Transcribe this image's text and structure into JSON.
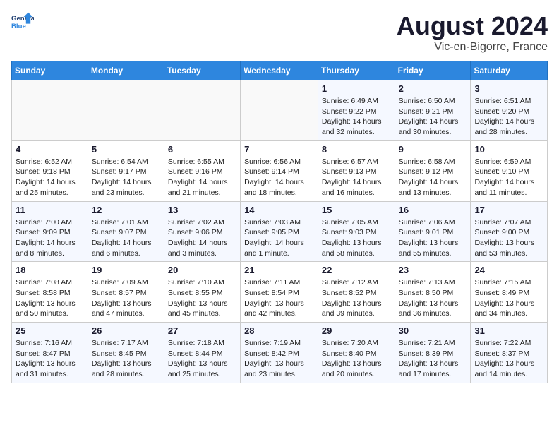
{
  "header": {
    "logo_line1": "General",
    "logo_line2": "Blue",
    "month_year": "August 2024",
    "location": "Vic-en-Bigorre, France"
  },
  "weekdays": [
    "Sunday",
    "Monday",
    "Tuesday",
    "Wednesday",
    "Thursday",
    "Friday",
    "Saturday"
  ],
  "weeks": [
    [
      {
        "day": "",
        "info": ""
      },
      {
        "day": "",
        "info": ""
      },
      {
        "day": "",
        "info": ""
      },
      {
        "day": "",
        "info": ""
      },
      {
        "day": "1",
        "info": "Sunrise: 6:49 AM\nSunset: 9:22 PM\nDaylight: 14 hours\nand 32 minutes."
      },
      {
        "day": "2",
        "info": "Sunrise: 6:50 AM\nSunset: 9:21 PM\nDaylight: 14 hours\nand 30 minutes."
      },
      {
        "day": "3",
        "info": "Sunrise: 6:51 AM\nSunset: 9:20 PM\nDaylight: 14 hours\nand 28 minutes."
      }
    ],
    [
      {
        "day": "4",
        "info": "Sunrise: 6:52 AM\nSunset: 9:18 PM\nDaylight: 14 hours\nand 25 minutes."
      },
      {
        "day": "5",
        "info": "Sunrise: 6:54 AM\nSunset: 9:17 PM\nDaylight: 14 hours\nand 23 minutes."
      },
      {
        "day": "6",
        "info": "Sunrise: 6:55 AM\nSunset: 9:16 PM\nDaylight: 14 hours\nand 21 minutes."
      },
      {
        "day": "7",
        "info": "Sunrise: 6:56 AM\nSunset: 9:14 PM\nDaylight: 14 hours\nand 18 minutes."
      },
      {
        "day": "8",
        "info": "Sunrise: 6:57 AM\nSunset: 9:13 PM\nDaylight: 14 hours\nand 16 minutes."
      },
      {
        "day": "9",
        "info": "Sunrise: 6:58 AM\nSunset: 9:12 PM\nDaylight: 14 hours\nand 13 minutes."
      },
      {
        "day": "10",
        "info": "Sunrise: 6:59 AM\nSunset: 9:10 PM\nDaylight: 14 hours\nand 11 minutes."
      }
    ],
    [
      {
        "day": "11",
        "info": "Sunrise: 7:00 AM\nSunset: 9:09 PM\nDaylight: 14 hours\nand 8 minutes."
      },
      {
        "day": "12",
        "info": "Sunrise: 7:01 AM\nSunset: 9:07 PM\nDaylight: 14 hours\nand 6 minutes."
      },
      {
        "day": "13",
        "info": "Sunrise: 7:02 AM\nSunset: 9:06 PM\nDaylight: 14 hours\nand 3 minutes."
      },
      {
        "day": "14",
        "info": "Sunrise: 7:03 AM\nSunset: 9:05 PM\nDaylight: 14 hours\nand 1 minute."
      },
      {
        "day": "15",
        "info": "Sunrise: 7:05 AM\nSunset: 9:03 PM\nDaylight: 13 hours\nand 58 minutes."
      },
      {
        "day": "16",
        "info": "Sunrise: 7:06 AM\nSunset: 9:01 PM\nDaylight: 13 hours\nand 55 minutes."
      },
      {
        "day": "17",
        "info": "Sunrise: 7:07 AM\nSunset: 9:00 PM\nDaylight: 13 hours\nand 53 minutes."
      }
    ],
    [
      {
        "day": "18",
        "info": "Sunrise: 7:08 AM\nSunset: 8:58 PM\nDaylight: 13 hours\nand 50 minutes."
      },
      {
        "day": "19",
        "info": "Sunrise: 7:09 AM\nSunset: 8:57 PM\nDaylight: 13 hours\nand 47 minutes."
      },
      {
        "day": "20",
        "info": "Sunrise: 7:10 AM\nSunset: 8:55 PM\nDaylight: 13 hours\nand 45 minutes."
      },
      {
        "day": "21",
        "info": "Sunrise: 7:11 AM\nSunset: 8:54 PM\nDaylight: 13 hours\nand 42 minutes."
      },
      {
        "day": "22",
        "info": "Sunrise: 7:12 AM\nSunset: 8:52 PM\nDaylight: 13 hours\nand 39 minutes."
      },
      {
        "day": "23",
        "info": "Sunrise: 7:13 AM\nSunset: 8:50 PM\nDaylight: 13 hours\nand 36 minutes."
      },
      {
        "day": "24",
        "info": "Sunrise: 7:15 AM\nSunset: 8:49 PM\nDaylight: 13 hours\nand 34 minutes."
      }
    ],
    [
      {
        "day": "25",
        "info": "Sunrise: 7:16 AM\nSunset: 8:47 PM\nDaylight: 13 hours\nand 31 minutes."
      },
      {
        "day": "26",
        "info": "Sunrise: 7:17 AM\nSunset: 8:45 PM\nDaylight: 13 hours\nand 28 minutes."
      },
      {
        "day": "27",
        "info": "Sunrise: 7:18 AM\nSunset: 8:44 PM\nDaylight: 13 hours\nand 25 minutes."
      },
      {
        "day": "28",
        "info": "Sunrise: 7:19 AM\nSunset: 8:42 PM\nDaylight: 13 hours\nand 23 minutes."
      },
      {
        "day": "29",
        "info": "Sunrise: 7:20 AM\nSunset: 8:40 PM\nDaylight: 13 hours\nand 20 minutes."
      },
      {
        "day": "30",
        "info": "Sunrise: 7:21 AM\nSunset: 8:39 PM\nDaylight: 13 hours\nand 17 minutes."
      },
      {
        "day": "31",
        "info": "Sunrise: 7:22 AM\nSunset: 8:37 PM\nDaylight: 13 hours\nand 14 minutes."
      }
    ]
  ]
}
